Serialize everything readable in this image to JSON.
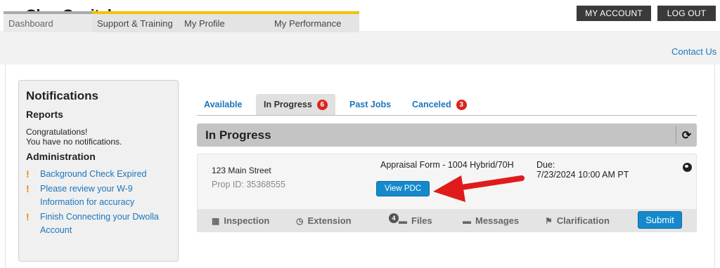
{
  "header": {
    "logo_text": "ClearCapital",
    "my_account_label": "MY ACCOUNT",
    "logout_label": "LOG OUT"
  },
  "nav": {
    "tabs": [
      {
        "label": "Dashboard"
      },
      {
        "label": "Support & Training"
      },
      {
        "label": "My Profile"
      },
      {
        "label": "My Performance"
      }
    ],
    "contact_label": "Contact Us",
    "accent_color": "#f5c200"
  },
  "notifications": {
    "title": "Notifications",
    "reports_heading": "Reports",
    "message_line1": "Congratulations!",
    "message_line2": "You have no notifications.",
    "admin_heading": "Administration",
    "admin_items": [
      {
        "label": "Background Check Expired"
      },
      {
        "label": "Please review your W-9 Information for accuracy"
      },
      {
        "label": "Finish Connecting your Dwolla Account"
      }
    ]
  },
  "job_tabs": [
    {
      "label": "Available",
      "count": null
    },
    {
      "label": "In Progress",
      "count": "6"
    },
    {
      "label": "Past Jobs",
      "count": null
    },
    {
      "label": "Canceled",
      "count": "3"
    }
  ],
  "section": {
    "title": "In Progress"
  },
  "job": {
    "address": "123 Main Street",
    "prop_id": "Prop ID: 35368555",
    "form": "Appraisal Form - 1004 Hybrid/70H",
    "view_pdc_label": "View PDC",
    "due_label": "Due:",
    "due_value": "7/23/2024 10:00 AM PT",
    "actions": [
      {
        "label": "Inspection",
        "icon": "calendar-icon"
      },
      {
        "label": "Extension",
        "icon": "clock-icon"
      },
      {
        "label": "Files",
        "icon": "folder-icon",
        "count": "4"
      },
      {
        "label": "Messages",
        "icon": "chat-icon"
      },
      {
        "label": "Clarification",
        "icon": "flag-icon"
      }
    ],
    "submit_label": "Submit"
  },
  "colors": {
    "link": "#1b75bb",
    "button": "#1589cc",
    "badge": "#d9261c",
    "arrow": "#e01b1b"
  }
}
